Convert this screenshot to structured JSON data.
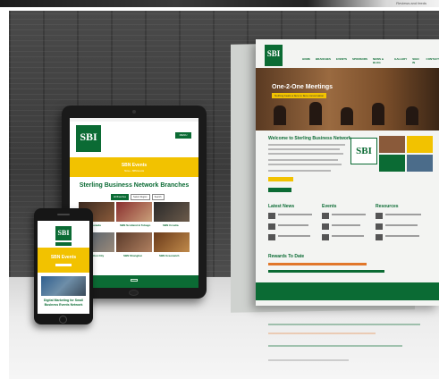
{
  "top_strip": {
    "text": "Reviews and feeds"
  },
  "brand": {
    "logo": "SBI",
    "green": "#0b6b34",
    "gold": "#f2c200"
  },
  "poster": {
    "nav": [
      "HOME",
      "BRANCHES",
      "EVENTS",
      "SPONSORS",
      "NEWS & BLOG",
      "GALLERY",
      "SIGN IN",
      "CONTACT"
    ],
    "hero_title": "One-2-One Meetings",
    "hero_subtitle": "Nothing beats a face to face conversation",
    "welcome": "Welcome to Sterling Business Network",
    "columns": [
      "Latest News",
      "Events",
      "Resources"
    ],
    "results": "Rewards To Date"
  },
  "tablet": {
    "menu_label": "MENU",
    "events_title": "SBN Events",
    "crumb": "Home  ›  SBN Events",
    "branches_title": "Sterling Business Network Branches",
    "filters": [
      "All Branches",
      "Select Region",
      "Search"
    ],
    "branches": [
      "Canada",
      "SBN Scotland & Tobago",
      "SBN Croatia",
      "Cotton City",
      "SBN Shanghai",
      "SBN Greenwich"
    ]
  },
  "phone": {
    "events_title": "SBN Events",
    "caption": "Digital Marketing for Small Business Events Network"
  }
}
